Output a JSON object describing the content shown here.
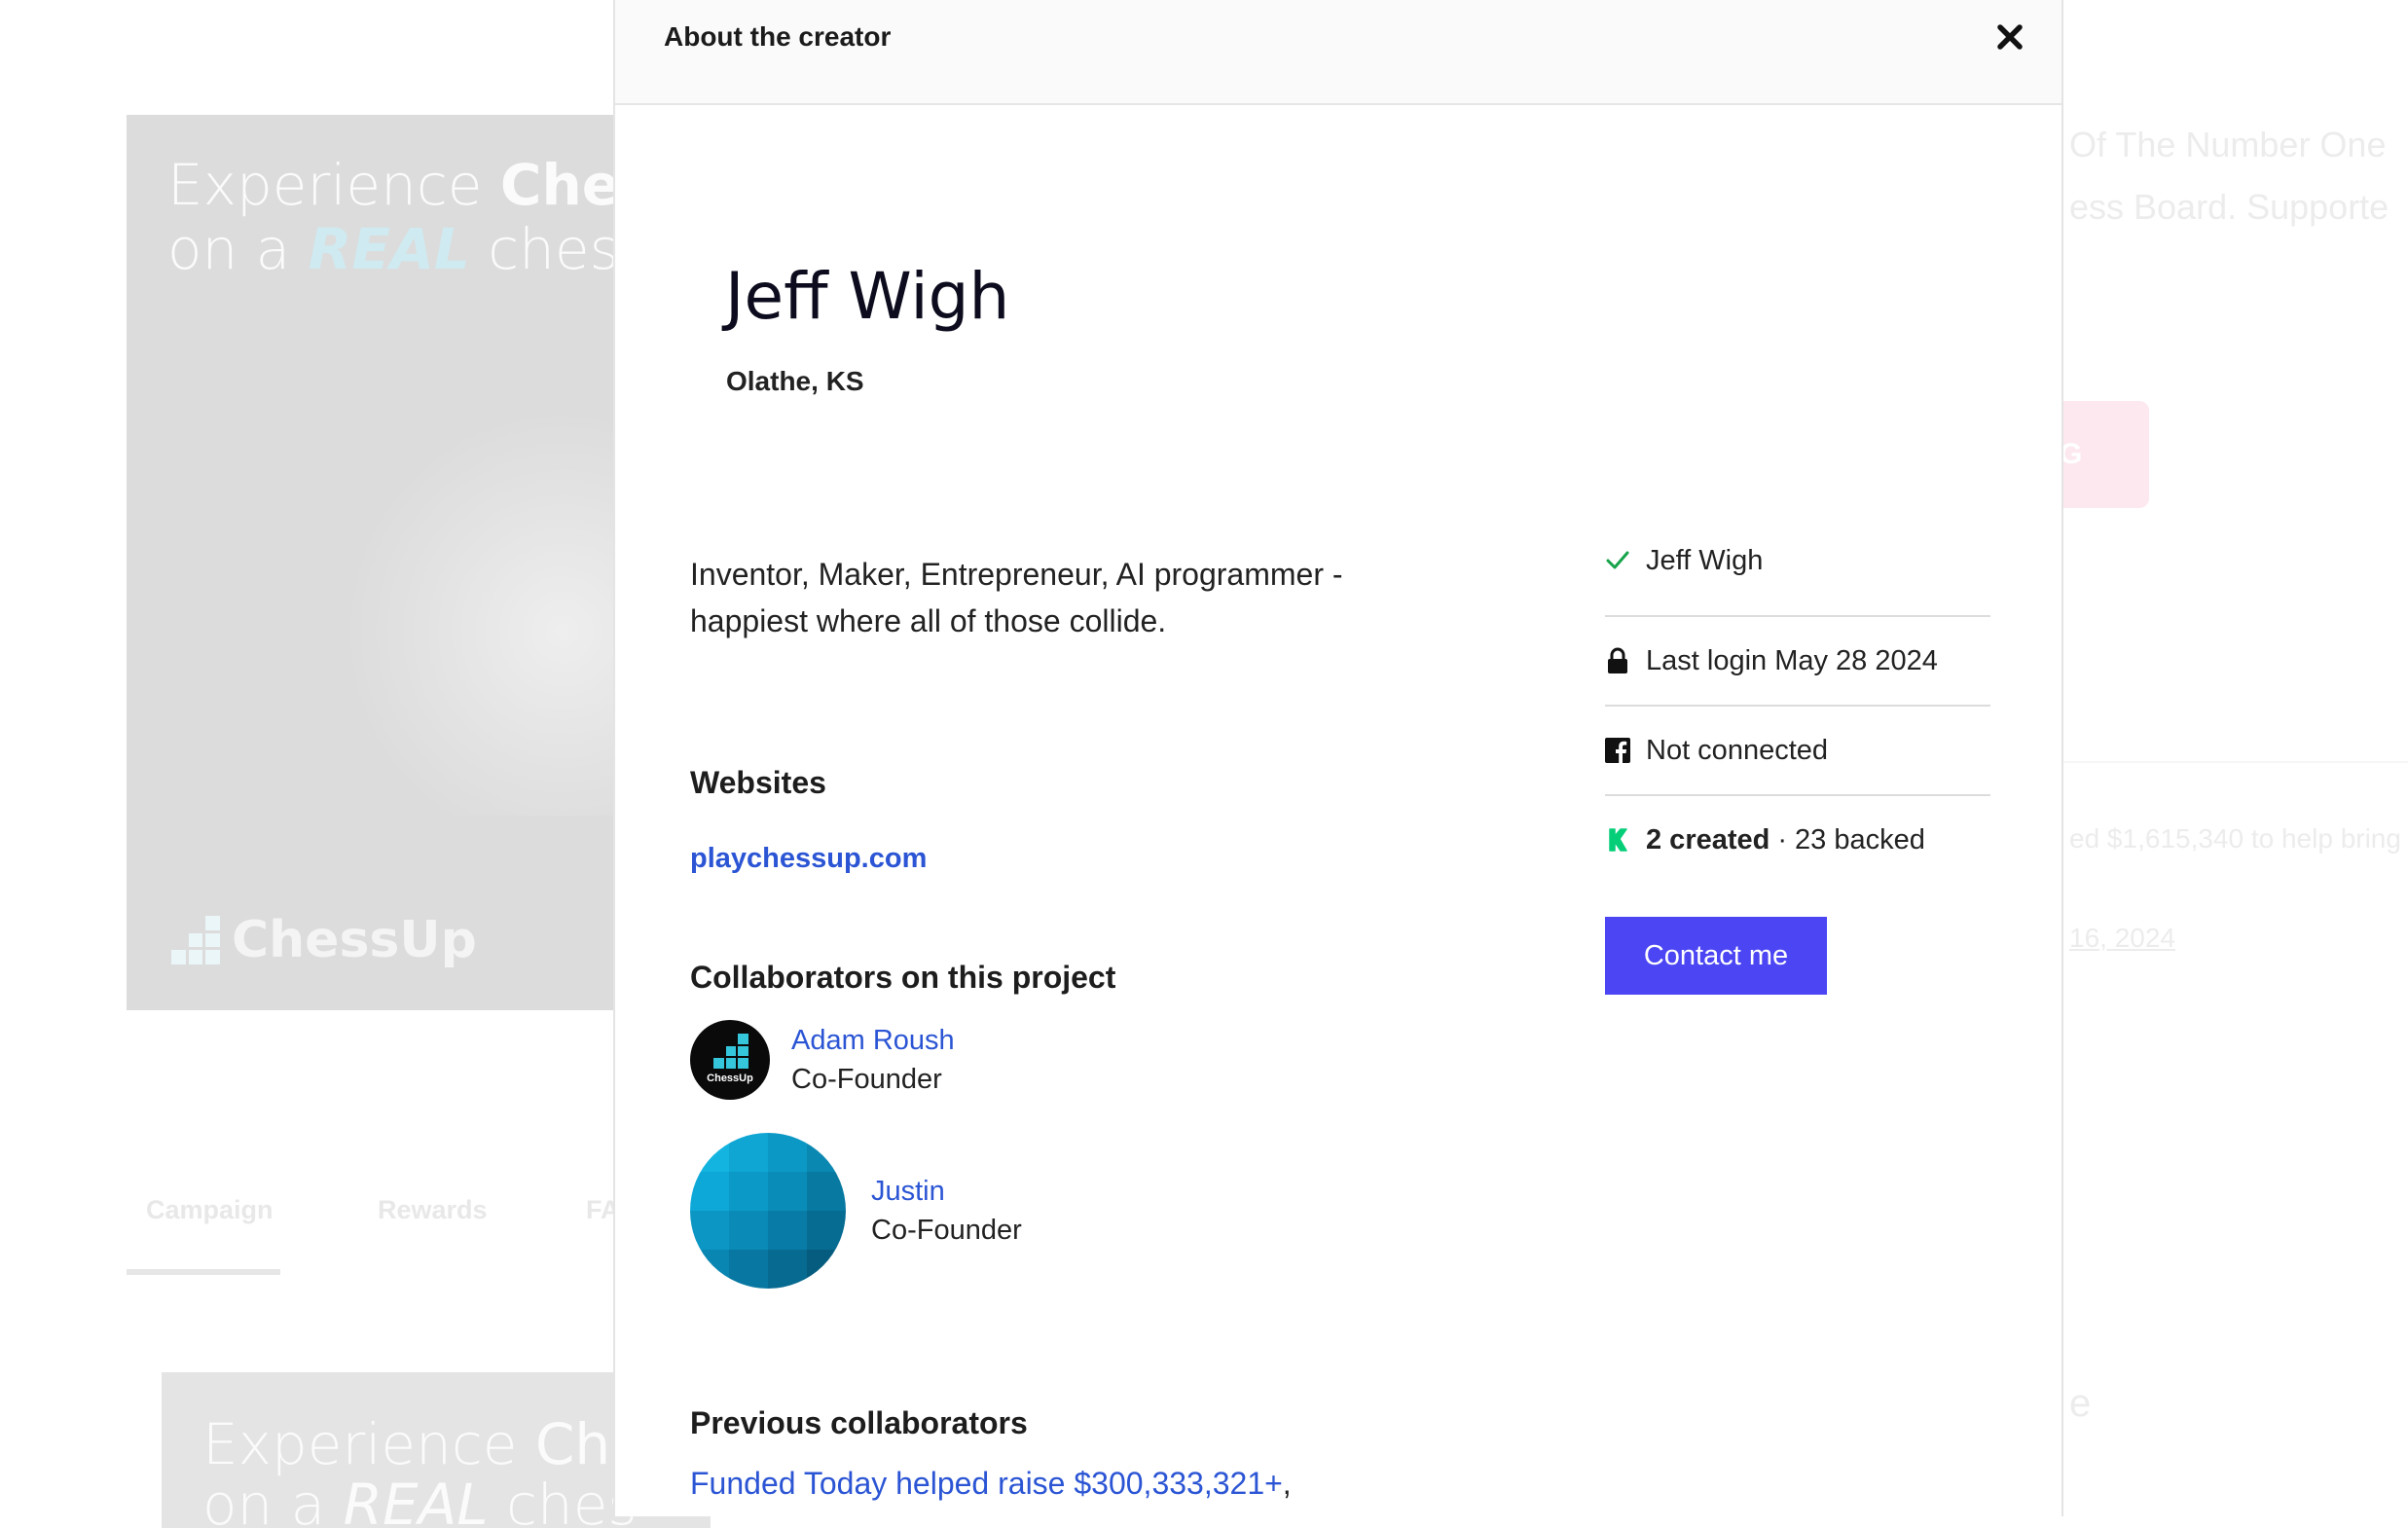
{
  "background": {
    "hero_line1_regular": "Experience ",
    "hero_line1_bold": "Ches",
    "hero_line2_regular": "on a ",
    "hero_line2_italic": "REAL",
    "hero_line2_end": " chess",
    "hero2_line1_regular": "Experience ",
    "hero2_line1_bold": "Che",
    "hero2_line2_regular": "on a ",
    "hero2_line2_italic": "REAL",
    "hero2_line2_end": " ches",
    "logo_text": "ChessUp",
    "tabs": [
      "Campaign",
      "Rewards",
      "FA("
    ],
    "right_line1": "Of The Number One",
    "right_line2": "ess Board. Supporte",
    "pink_button_partial": "G",
    "right_line3": "ed $1,615,340 to help bring",
    "right_line4": " 16, 2024",
    "right_line5": "e"
  },
  "modal": {
    "title": "About the creator",
    "creator_name": "Jeff Wigh",
    "location": "Olathe, KS",
    "bio": "Inventor, Maker, Entrepreneur, AI programmer - happiest where all of those collide.",
    "websites_heading": "Websites",
    "website": "playchessup.com",
    "collaborators_heading": "Collaborators on this project",
    "collaborators": [
      {
        "name": "Adam Roush",
        "role": "Co-Founder",
        "avatar_text": "ChessUp"
      },
      {
        "name": "Justin",
        "role": "Co-Founder"
      }
    ],
    "previous_heading": "Previous collaborators",
    "previous_link": "Funded Today helped raise $300,333,321+",
    "previous_trailing": ","
  },
  "sidebar": {
    "verified_name": "Jeff Wigh",
    "last_login": "Last login May 28 2024",
    "facebook_status": "Not connected",
    "created": "2 created",
    "backed_sep": "·",
    "backed": "23 backed",
    "contact_label": "Contact me"
  },
  "colors": {
    "accent_button": "#4b45f3",
    "link": "#2b55d4",
    "kickstarter_green": "#05ce78",
    "check_green": "#16a34a"
  },
  "icons": [
    "close-icon",
    "checkmark-icon",
    "lock-icon",
    "facebook-icon",
    "kickstarter-icon"
  ]
}
